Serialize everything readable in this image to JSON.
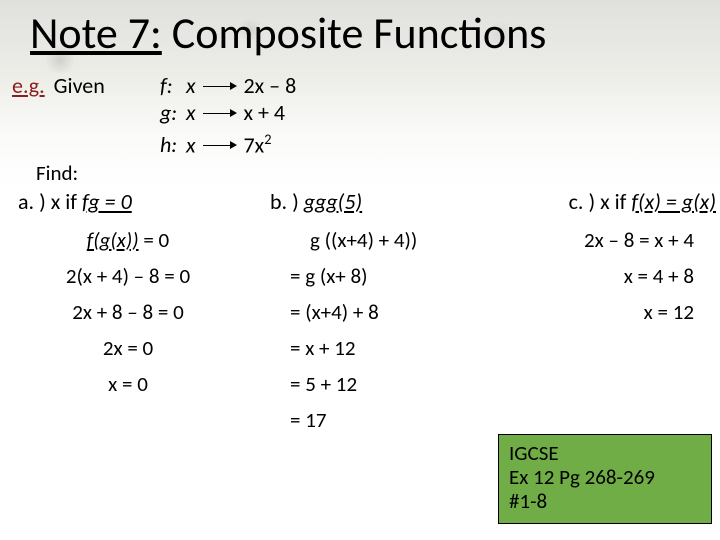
{
  "title": {
    "underline": "Note 7:",
    "rest": "  Composite Functions"
  },
  "eg": {
    "label": "e.g.",
    "given": "Given"
  },
  "defs": {
    "f": {
      "name": "f:",
      "var": "x",
      "rhs": "2x – 8"
    },
    "g": {
      "name": "g:",
      "var": "x",
      "rhs": "x + 4"
    },
    "h": {
      "name": "h:",
      "var": "x",
      "rhs": "7x",
      "exp": "2"
    }
  },
  "find": "Find:",
  "a": {
    "head_pre": "a. )  x if ",
    "head_it": "fg = 0",
    "s1_it": "f(g(x))",
    "s1_rest": " = 0",
    "s2": "2(x + 4) – 8 = 0",
    "s3": "2x + 8 – 8 = 0",
    "s4": "2x = 0",
    "s5": "x = 0"
  },
  "b": {
    "head_pre": "b. )  ",
    "head_it": "ggg(5)",
    "s1": "g ((x+4) + 4))",
    "s2": "= g (x+ 8)",
    "s3": "= (x+4) + 8",
    "s4": "= x + 12",
    "s5": "= 5 + 12",
    "s6": "= 17"
  },
  "c": {
    "head_pre": "c. ) x if ",
    "head_it": "f(x) = g(x)",
    "s1": "2x – 8 = x + 4",
    "s2": "x  = 4 + 8",
    "s3": "x  = 12"
  },
  "hw": {
    "l1": "IGCSE",
    "l2": "Ex 12  Pg 268-269",
    "l3": "#1-8"
  }
}
